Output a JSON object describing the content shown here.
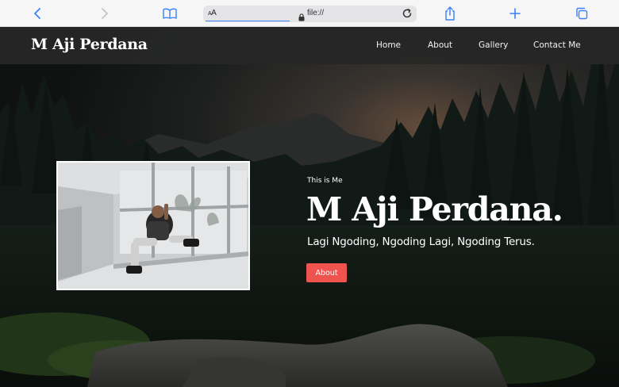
{
  "browser": {
    "aa_small": "A",
    "aa_large": "A",
    "url": "file://"
  },
  "site": {
    "brand": "M Aji Perdana",
    "nav": [
      "Home",
      "About",
      "Gallery",
      "Contact Me"
    ]
  },
  "hero": {
    "pretitle": "This is Me",
    "title": "M Aji Perdana.",
    "subtitle": "Lagi Ngoding, Ngoding Lagi, Ngoding Terus.",
    "button_label": "About"
  },
  "colors": {
    "navbar": "#262626",
    "accent_button": "#ef5350",
    "browser_blue": "#3b82f6"
  },
  "icons": [
    "back-icon",
    "forward-icon",
    "bookmarks-icon",
    "lock-icon",
    "reload-icon",
    "share-icon",
    "new-tab-icon",
    "tabs-icon"
  ]
}
